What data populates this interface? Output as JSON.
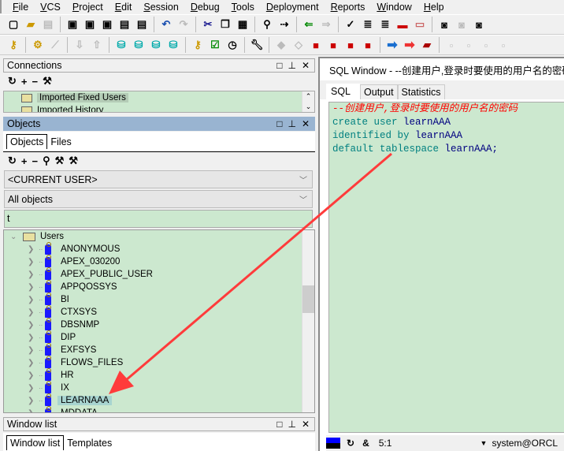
{
  "menu": [
    "File",
    "VCS",
    "Project",
    "Edit",
    "Session",
    "Debug",
    "Tools",
    "Deployment",
    "Reports",
    "Window",
    "Help"
  ],
  "connections": {
    "title": "Connections",
    "items": [
      "Imported Fixed Users",
      "Imported History"
    ]
  },
  "objects": {
    "title": "Objects",
    "tabs": [
      "Objects",
      "Files"
    ],
    "user_select": "<CURRENT USER>",
    "type_select": "All objects",
    "filter_value": "t",
    "tree_root": "Users",
    "users": [
      "ANONYMOUS",
      "APEX_030200",
      "APEX_PUBLIC_USER",
      "APPQOSSYS",
      "BI",
      "CTXSYS",
      "DBSNMP",
      "DIP",
      "EXFSYS",
      "FLOWS_FILES",
      "HR",
      "IX",
      "LEARNAAA",
      "MDDATA"
    ],
    "selected_user": "LEARNAAA"
  },
  "window_list": {
    "title": "Window list",
    "tabs": [
      "Window list",
      "Templates"
    ]
  },
  "sql_window": {
    "title": "SQL Window - --创建用户,登录时要使用的用户名的密码",
    "tabs": [
      "SQL",
      "Output",
      "Statistics"
    ],
    "code": {
      "comment": "--创建用户,登录时要使用的用户名的密码",
      "l2_kw": "create user ",
      "l2_id": "learnAAA",
      "l3_kw": "identified by ",
      "l3_id": "learnAAA",
      "l4_kw": "default tablespace ",
      "l4_id": "learnAAA;"
    }
  },
  "status": {
    "position": "5:1",
    "connection": "system@ORCL",
    "amp": "&"
  },
  "colors": {
    "editor_bg": "#cce8cf",
    "panel_active": "#99b4d1",
    "annotation_arrow": "#ff3b3b"
  }
}
